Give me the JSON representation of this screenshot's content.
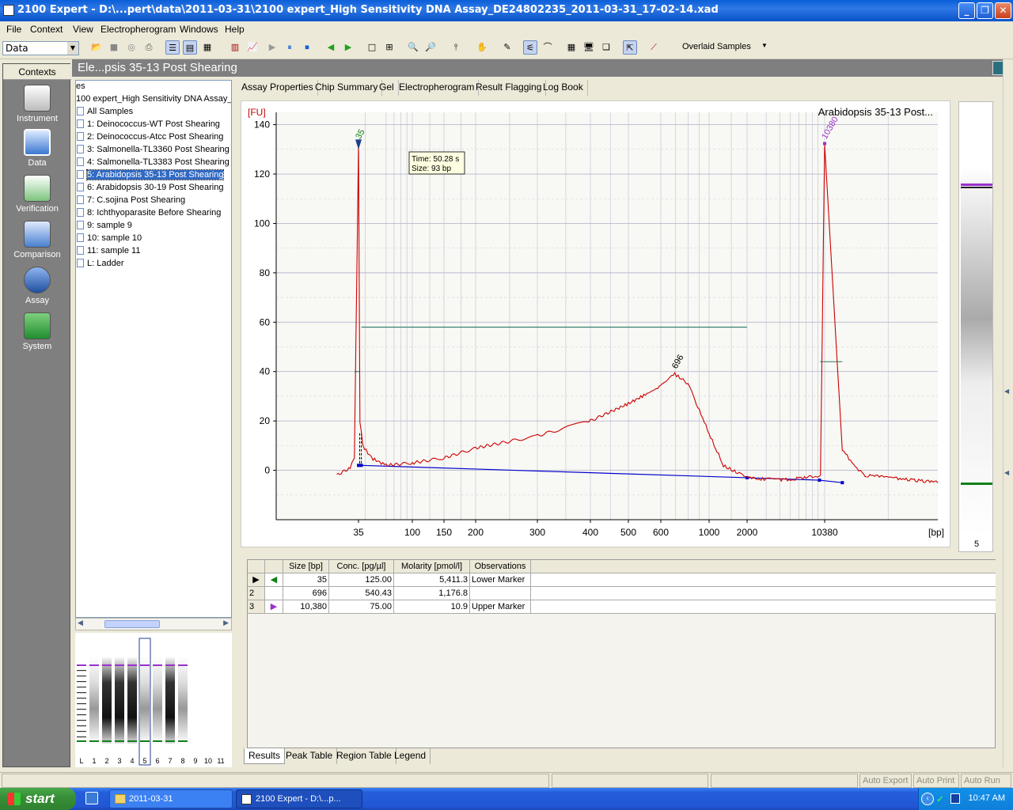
{
  "window": {
    "title": "2100 Expert - D:\\...pert\\data\\2011-03-31\\2100 expert_High Sensitivity DNA Assay_DE24802235_2011-03-31_17-02-14.xad"
  },
  "menu": {
    "items": [
      "File",
      "Context",
      "View",
      "Electropherogram",
      "Windows",
      "Help"
    ]
  },
  "toolbar": {
    "context_value": "Data",
    "overlay_option": "Overlaid Samples"
  },
  "contexts": {
    "header": "Contexts",
    "items": [
      {
        "label": "Instrument",
        "icon": "instrument-icon"
      },
      {
        "label": "Data",
        "icon": "data-icon"
      },
      {
        "label": "Verification",
        "icon": "verification-icon"
      },
      {
        "label": "Comparison",
        "icon": "comparison-icon"
      },
      {
        "label": "Assay",
        "icon": "assay-icon"
      },
      {
        "label": "System",
        "icon": "system-icon"
      }
    ]
  },
  "header": {
    "title": "Ele...psis 35-13 Post Shearing"
  },
  "tree": {
    "items": [
      "es",
      "100 expert_High Sensitivity DNA Assay_",
      "All Samples",
      "1: Deinococcus-WT Post Shearing",
      "2: Deinococcus-Atcc Post Shearing",
      "3: Salmonella-TL3360 Post Shearing",
      "4: Salmonella-TL3383 Post Shearing",
      "5: Arabidopsis 35-13 Post Shearing",
      "6: Arabidopsis 30-19 Post Shearing",
      "7: C.sojina Post Shearing",
      "8: Ichthyoparasite Before Shearing",
      "9: sample 9",
      "10: sample 10",
      "11: sample 11",
      "L: Ladder"
    ],
    "selected_index": 7
  },
  "tabs": [
    "Assay Properties",
    "Chip Summary",
    "Gel",
    "Electropherogram",
    "Result Flagging",
    "Log Book"
  ],
  "gel_thumb": {
    "lanes": [
      "L",
      "1",
      "2",
      "3",
      "4",
      "5",
      "6",
      "7",
      "8",
      "9",
      "10",
      "11"
    ],
    "selected": "5"
  },
  "chart_data": {
    "type": "line",
    "title": "Arabidopsis 35-13 Post...",
    "ylabel": "[FU]",
    "xlabel": "[bp]",
    "ylim": [
      -20,
      145
    ],
    "yticks": [
      0,
      20,
      40,
      60,
      80,
      100,
      120,
      140
    ],
    "xticks": [
      "35",
      "100",
      "150",
      "200",
      "300",
      "400",
      "500",
      "600",
      "1000",
      "2000",
      "10380"
    ],
    "grid": true,
    "series": [
      {
        "points": [
          [
            30,
            -2
          ],
          [
            33,
            1
          ],
          [
            34,
            5
          ],
          [
            35,
            132
          ],
          [
            36,
            20
          ],
          [
            38,
            10
          ],
          [
            45,
            5
          ],
          [
            60,
            2
          ],
          [
            100,
            3
          ],
          [
            150,
            5
          ],
          [
            200,
            9
          ],
          [
            300,
            14
          ],
          [
            400,
            20
          ],
          [
            500,
            27
          ],
          [
            600,
            34
          ],
          [
            696,
            39
          ],
          [
            800,
            35
          ],
          [
            1000,
            15
          ],
          [
            1300,
            2
          ],
          [
            2000,
            -3
          ],
          [
            4000,
            -4
          ],
          [
            7000,
            -3
          ],
          [
            9500,
            -2
          ],
          [
            10380,
            132
          ],
          [
            11500,
            8
          ],
          [
            13000,
            -2
          ],
          [
            20000,
            -5
          ]
        ]
      }
    ],
    "peak_labels": [
      {
        "text": "35",
        "x": 35,
        "y": 132
      },
      {
        "text": "696",
        "x": 696,
        "y": 39
      },
      {
        "text": "10380",
        "x": 10380,
        "y": 132
      }
    ],
    "tooltip": {
      "time": "Time: 50.28 s",
      "size": "Size: 93 bp"
    },
    "lane_label": "5"
  },
  "peak_table": {
    "headers": [
      "Size [bp]",
      "Conc. [pg/µl]",
      "Molarity [pmol/l]",
      "Observations"
    ],
    "rows": [
      {
        "num": "",
        "size": "35",
        "conc": "125.00",
        "molarity": "5,411.3",
        "obs": "Lower Marker"
      },
      {
        "num": "2",
        "size": "696",
        "conc": "540.43",
        "molarity": "1,176.8",
        "obs": ""
      },
      {
        "num": "3",
        "size": "10,380",
        "conc": "75.00",
        "molarity": "10.9",
        "obs": "Upper Marker"
      }
    ]
  },
  "bottom_tabs": [
    "Results",
    "Peak Table",
    "Region Table",
    "Legend"
  ],
  "status": {
    "auto_export": "Auto Export",
    "auto_print": "Auto Print",
    "auto_run": "Auto Run"
  },
  "taskbar": {
    "start": "start",
    "tasks": [
      "2011-03-31",
      "2100 Expert - D:\\...p..."
    ],
    "clock": "10:47 AM"
  },
  "colors": {
    "trace": "#cc0000",
    "baseline": "#0000cc",
    "accent": "#316ac5",
    "lower_marker": "#00a000",
    "upper_marker": "#9932cc"
  }
}
